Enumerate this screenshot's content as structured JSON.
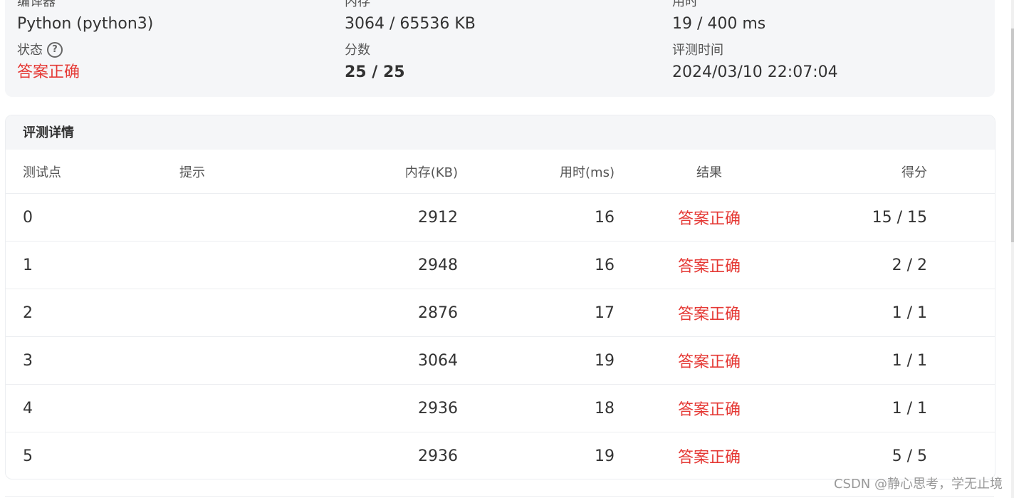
{
  "summary": {
    "compiler": {
      "label": "编译器",
      "value": "Python (python3)"
    },
    "memory": {
      "label": "内存",
      "value": "3064 / 65536 KB"
    },
    "time": {
      "label": "用时",
      "value": "19 / 400 ms"
    },
    "status": {
      "label": "状态",
      "value": "答案正确",
      "help_icon": "question-circle-icon"
    },
    "score": {
      "label": "分数",
      "value": "25 / 25"
    },
    "judge_time": {
      "label": "评测时间",
      "value": "2024/03/10 22:07:04"
    }
  },
  "details": {
    "title": "评测详情",
    "columns": [
      "测试点",
      "提示",
      "内存(KB)",
      "用时(ms)",
      "结果",
      "得分"
    ],
    "rows": [
      {
        "id": "0",
        "hint": "",
        "memory": "2912",
        "time": "16",
        "result": "答案正确",
        "score": "15 / 15"
      },
      {
        "id": "1",
        "hint": "",
        "memory": "2948",
        "time": "16",
        "result": "答案正确",
        "score": "2 / 2"
      },
      {
        "id": "2",
        "hint": "",
        "memory": "2876",
        "time": "17",
        "result": "答案正确",
        "score": "1 / 1"
      },
      {
        "id": "3",
        "hint": "",
        "memory": "3064",
        "time": "19",
        "result": "答案正确",
        "score": "1 / 1"
      },
      {
        "id": "4",
        "hint": "",
        "memory": "2936",
        "time": "18",
        "result": "答案正确",
        "score": "1 / 1"
      },
      {
        "id": "5",
        "hint": "",
        "memory": "2936",
        "time": "19",
        "result": "答案正确",
        "score": "5 / 5"
      }
    ]
  },
  "watermark": "CSDN @静心思考，学无止境",
  "colors": {
    "accepted": "#e53935",
    "card_bg": "#f5f6f8",
    "text": "#333333"
  }
}
